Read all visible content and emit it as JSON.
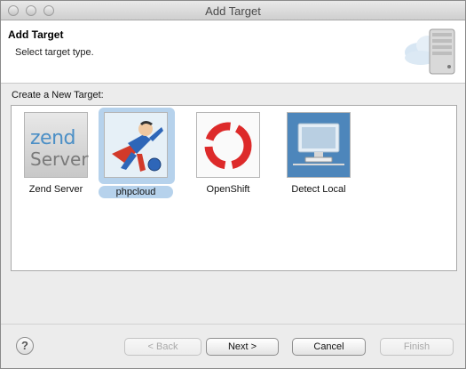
{
  "window": {
    "title": "Add Target"
  },
  "header": {
    "title": "Add Target",
    "subtitle": "Select target type."
  },
  "section": {
    "label": "Create a New Target:"
  },
  "targets": [
    {
      "label": "Zend Server",
      "selected": false,
      "logo_text": [
        "zend",
        "Server"
      ]
    },
    {
      "label": "phpcloud",
      "selected": true
    },
    {
      "label": "OpenShift",
      "selected": false
    },
    {
      "label": "Detect Local",
      "selected": false
    }
  ],
  "buttons": {
    "help": "?",
    "back": "< Back",
    "next": "Next >",
    "cancel": "Cancel",
    "finish": "Finish"
  },
  "colors": {
    "selection": "#b6d2ec",
    "zend_blue": "#4b8fc6",
    "openshift_red": "#dd2a2a"
  }
}
